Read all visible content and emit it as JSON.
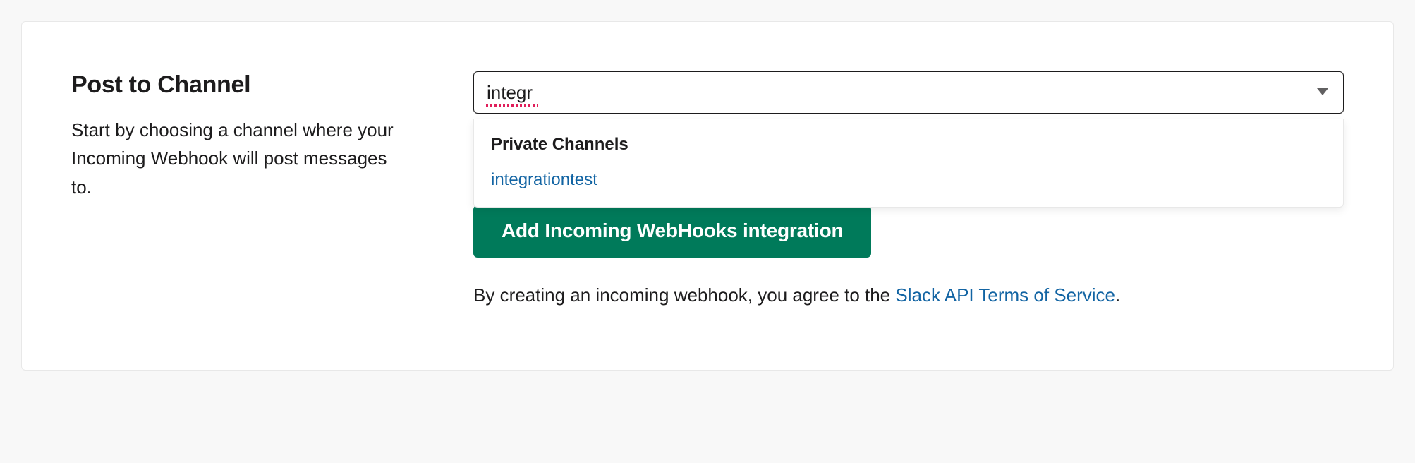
{
  "section": {
    "title": "Post to Channel",
    "description": "Start by choosing a channel where your Incoming Webhook will post messages to."
  },
  "channel_select": {
    "value": "integr",
    "group_label": "Private Channels",
    "options": [
      {
        "label": "integrationtest"
      }
    ]
  },
  "actions": {
    "add_button_label": "Add Incoming WebHooks integration"
  },
  "terms": {
    "prefix": "By creating an incoming webhook, you agree to the ",
    "link_text": "Slack API Terms of Service",
    "suffix": "."
  }
}
